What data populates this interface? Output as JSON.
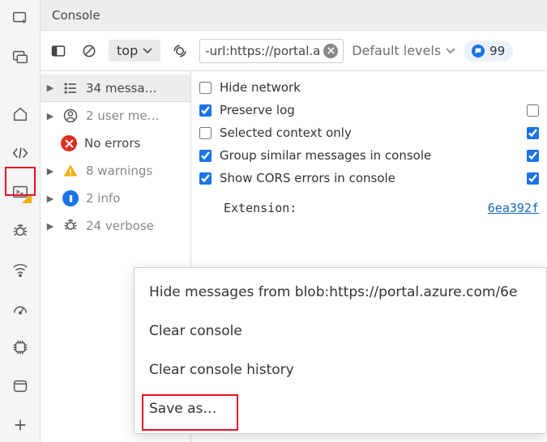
{
  "title": "Console",
  "toolbar": {
    "context_label": "top",
    "filter_value": "-url:https://portal.a",
    "levels_label": "Default levels",
    "issues_count": "99"
  },
  "sidebar": {
    "items": [
      {
        "label": "34 messa…",
        "muted": false
      },
      {
        "label": "2 user me…",
        "muted": true
      },
      {
        "label": "No errors",
        "muted": false
      },
      {
        "label": "8 warnings",
        "muted": true
      },
      {
        "label": "2 info",
        "muted": true
      },
      {
        "label": "24 verbose",
        "muted": true
      }
    ]
  },
  "settings": {
    "hide_network": "Hide network",
    "preserve_log": "Preserve log",
    "selected_context": "Selected context only",
    "group_similar": "Group similar messages in console",
    "show_cors": "Show CORS errors in console"
  },
  "extension": {
    "label": "Extension:",
    "link": "6ea392f"
  },
  "context_menu": {
    "hide_from": "Hide messages from blob:https://portal.azure.com/6e",
    "clear_console": "Clear console",
    "clear_history": "Clear console history",
    "save_as": "Save as…"
  }
}
